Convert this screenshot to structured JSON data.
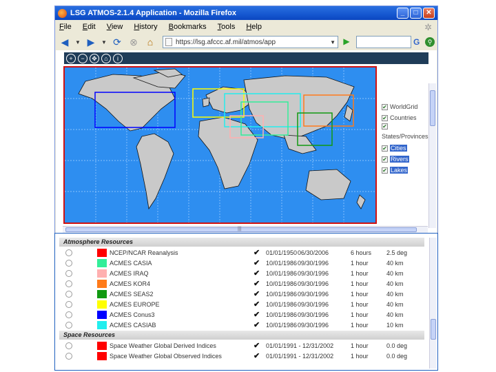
{
  "window": {
    "title": "LSG ATMOS-2.1.4 Application - Mozilla Firefox",
    "controls": [
      "_",
      "□",
      "✕"
    ]
  },
  "menu": [
    "File",
    "Edit",
    "View",
    "History",
    "Bookmarks",
    "Tools",
    "Help"
  ],
  "navigation": {
    "url": "https://lsg.afccc.af.mil/atmos/app",
    "search_engine": "G",
    "icons": [
      "back-icon",
      "forward-icon",
      "reload-icon",
      "stop-icon",
      "home-icon",
      "go-icon",
      "search-icon"
    ]
  },
  "map_tools": {
    "icons": [
      "zoom-in-icon",
      "zoom-out-icon",
      "pan-icon",
      "home-icon",
      "info-icon"
    ]
  },
  "layers": [
    {
      "label": "WorldGrid",
      "checked": true,
      "selected": false
    },
    {
      "label": "Countries",
      "checked": true,
      "selected": false
    },
    {
      "label": "States/Provinces",
      "checked": true,
      "selected": false
    },
    {
      "label": "Cities",
      "checked": true,
      "selected": true
    },
    {
      "label": "Rivers",
      "checked": true,
      "selected": true
    },
    {
      "label": "Lakes",
      "checked": true,
      "selected": true
    }
  ],
  "sections": {
    "atmosphere": "Atmosphere Resources",
    "space": "Space Resources"
  },
  "atmosphere_resources": [
    {
      "name": "NCEP/NCAR Reanalysis",
      "color": "#ff0000",
      "start": "01/01/1950",
      "end": "06/30/2006",
      "step": "6 hours",
      "resolution": "2.5 deg"
    },
    {
      "name": "ACMES CASIA",
      "color": "#33ee99",
      "start": "10/01/1986",
      "end": "09/30/1996",
      "step": "1 hour",
      "resolution": "40 km"
    },
    {
      "name": "ACMES IRAQ",
      "color": "#ffb0b0",
      "start": "10/01/1986",
      "end": "09/30/1996",
      "step": "1 hour",
      "resolution": "40 km"
    },
    {
      "name": "ACMES KOR4",
      "color": "#ff7b1a",
      "start": "10/01/1986",
      "end": "09/30/1996",
      "step": "1 hour",
      "resolution": "40 km"
    },
    {
      "name": "ACMES SEAS2",
      "color": "#119911",
      "start": "10/01/1986",
      "end": "09/30/1996",
      "step": "1 hour",
      "resolution": "40 km"
    },
    {
      "name": "ACMES EUROPE",
      "color": "#ffff00",
      "start": "10/01/1986",
      "end": "09/30/1996",
      "step": "1 hour",
      "resolution": "40 km"
    },
    {
      "name": "ACMES Conus3",
      "color": "#0000ff",
      "start": "10/01/1986",
      "end": "09/30/1996",
      "step": "1 hour",
      "resolution": "40 km"
    },
    {
      "name": "ACMES CASIAB",
      "color": "#22eeee",
      "start": "10/01/1986",
      "end": "09/30/1996",
      "step": "1 hour",
      "resolution": "10 km"
    }
  ],
  "space_resources": [
    {
      "name": "Space Weather Global Derived Indices",
      "color": "#ff0000",
      "range": "01/01/1991 - 12/31/2002",
      "step": "1 hour",
      "resolution": "0.0 deg"
    },
    {
      "name": "Space Weather Global Observed Indices",
      "color": "#ff0000",
      "range": "01/01/1991 - 12/31/2002",
      "step": "1 hour",
      "resolution": "0.0 deg"
    }
  ],
  "check_mark": "✔"
}
